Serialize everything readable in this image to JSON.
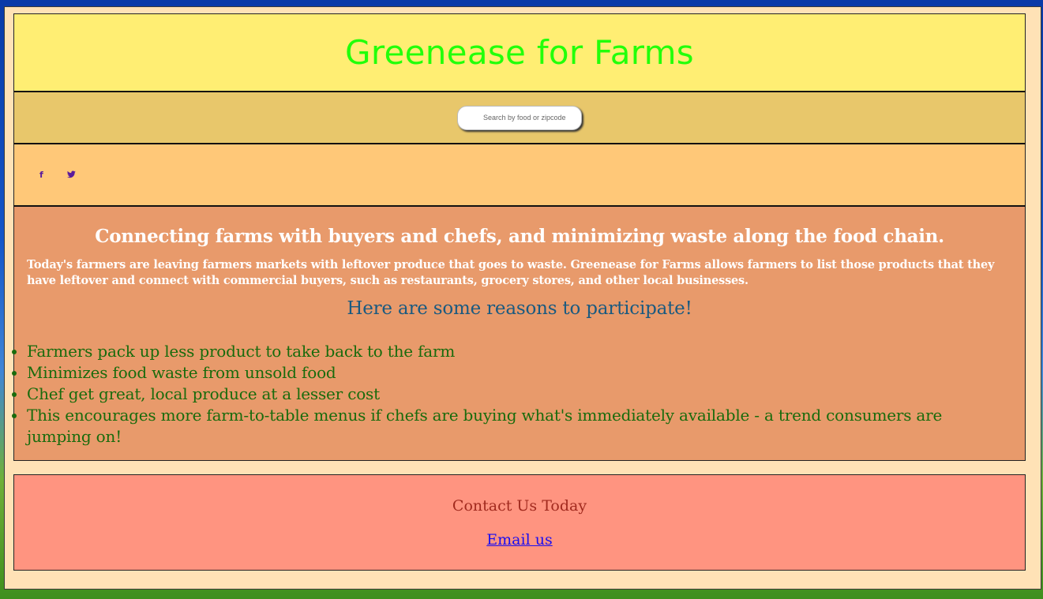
{
  "header": {
    "title": "Greenease for Farms"
  },
  "search": {
    "placeholder": "Search by food or zipcode"
  },
  "social": {
    "facebook_icon": "f",
    "twitter_icon": "☳"
  },
  "main": {
    "heading": "Connecting farms with buyers and chefs, and minimizing waste along the food chain.",
    "intro": "Today's farmers are leaving farmers markets with leftover produce that goes to waste. Greenease for Farms allows farmers to list those products that they have leftover and connect with commercial buyers, such as restaurants, grocery stores, and other local businesses.",
    "reasons_heading": "Here are some reasons to participate!",
    "reasons": [
      "Farmers pack up less product to take back to the farm",
      "Minimizes food waste from unsold food",
      "Chef get great, local produce at a lesser cost",
      "This encourages more farm-to-table menus if chefs are buying what's immediately available - a trend consumers are jumping on!"
    ]
  },
  "contact": {
    "heading": "Contact Us Today",
    "email_link": "Email us"
  },
  "colors": {
    "title": "#22ff0a",
    "header_bg": "#ffee73",
    "search_bg": "#e8c76b",
    "social_bg": "#ffc878",
    "content_bg": "#e89a6b",
    "contact_bg": "#ff9480",
    "list_text": "#196b0c",
    "reasons_heading": "#1a5a80"
  }
}
